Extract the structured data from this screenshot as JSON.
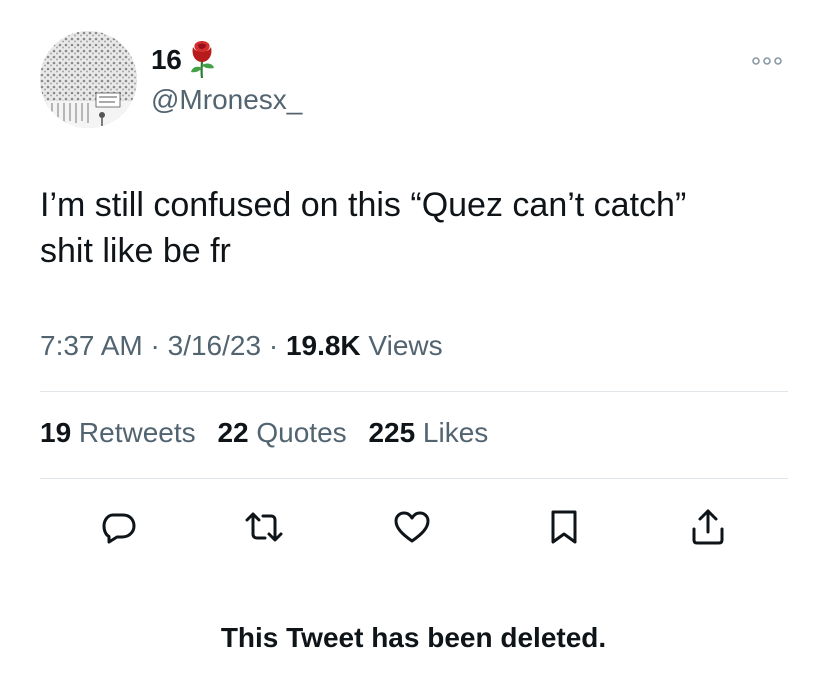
{
  "tweet": {
    "display_name": "16",
    "display_name_emoji": "rose-icon",
    "handle": "@Mronesx_",
    "text_line1": "I’m still confused on this “Quez can’t catch”",
    "text_line2": "shit like be fr",
    "time": "7:37 AM",
    "separator": " · ",
    "date": "3/16/23",
    "views_count": "19.8K",
    "views_label": " Views"
  },
  "stats": {
    "retweets_count": "19",
    "retweets_label": " Retweets",
    "quotes_count": "22",
    "quotes_label": " Quotes",
    "likes_count": "225",
    "likes_label": " Likes"
  },
  "actions": [
    "reply-icon",
    "retweet-icon",
    "like-icon",
    "bookmark-icon",
    "share-icon"
  ],
  "notice": {
    "deleted": "This Tweet has been deleted."
  },
  "colors": {
    "text_primary": "#0f1419",
    "text_secondary": "#536471",
    "divider": "#e1e6ea",
    "rose": "#c8102e"
  }
}
